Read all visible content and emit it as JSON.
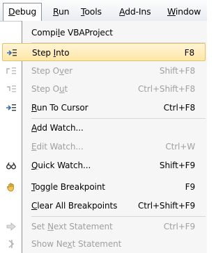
{
  "menubar": {
    "items": [
      {
        "pre": "",
        "mn": "D",
        "post": "ebug",
        "active": true
      },
      {
        "pre": "",
        "mn": "R",
        "post": "un"
      },
      {
        "pre": "",
        "mn": "T",
        "post": "ools"
      },
      {
        "pre": "",
        "mn": "A",
        "post": "dd-Ins"
      },
      {
        "pre": "",
        "mn": "W",
        "post": "indow"
      }
    ]
  },
  "menu": {
    "items": [
      {
        "pre": "Compi",
        "mn": "l",
        "post": "e VBAProject",
        "shortcut": "",
        "icon": "",
        "disabled": false
      },
      {
        "pre": "Step ",
        "mn": "I",
        "post": "nto",
        "shortcut": "F8",
        "icon": "step-into-icon",
        "disabled": false,
        "highlight": true
      },
      {
        "pre": "Step O",
        "mn": "v",
        "post": "er",
        "shortcut": "Shift+F8",
        "icon": "step-over-icon",
        "disabled": true
      },
      {
        "pre": "Step O",
        "mn": "u",
        "post": "t",
        "shortcut": "Ctrl+Shift+F8",
        "icon": "step-out-icon",
        "disabled": true
      },
      {
        "pre": "",
        "mn": "R",
        "post": "un To Cursor",
        "shortcut": "Ctrl+F8",
        "icon": "run-to-cursor-icon",
        "disabled": false
      },
      {
        "pre": "",
        "mn": "A",
        "post": "dd Watch...",
        "shortcut": "",
        "icon": "",
        "disabled": false
      },
      {
        "pre": "",
        "mn": "E",
        "post": "dit Watch...",
        "shortcut": "Ctrl+W",
        "icon": "",
        "disabled": true
      },
      {
        "pre": "",
        "mn": "Q",
        "post": "uick Watch...",
        "shortcut": "Shift+F9",
        "icon": "quick-watch-icon",
        "disabled": false
      },
      {
        "pre": "",
        "mn": "T",
        "post": "oggle Breakpoint",
        "shortcut": "F9",
        "icon": "toggle-breakpoint-icon",
        "disabled": false
      },
      {
        "pre": "",
        "mn": "C",
        "post": "lear All Breakpoints",
        "shortcut": "Ctrl+Shift+F9",
        "icon": "",
        "disabled": false
      },
      {
        "pre": "Set ",
        "mn": "N",
        "post": "ext Statement",
        "shortcut": "Ctrl+F9",
        "icon": "set-next-statement-icon",
        "disabled": true
      },
      {
        "pre": "Show Ne",
        "mn": "x",
        "post": "t Statement",
        "shortcut": "",
        "icon": "show-next-statement-icon",
        "disabled": true
      }
    ]
  }
}
